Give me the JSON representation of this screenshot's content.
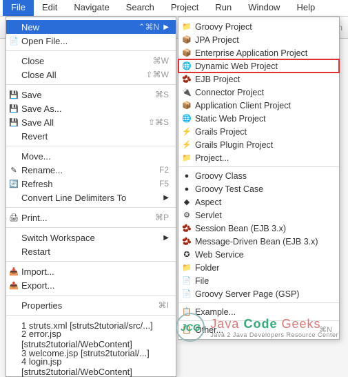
{
  "menubar": [
    "File",
    "Edit",
    "Navigate",
    "Search",
    "Project",
    "Run",
    "Window",
    "Help"
  ],
  "toolbar_right": "um",
  "file_menu": [
    {
      "label": "New",
      "shortcut": "⌃⌘N",
      "arrow": true,
      "highlight": true
    },
    {
      "label": "Open File...",
      "icon": "📄"
    },
    {
      "sep": true
    },
    {
      "label": "Close",
      "shortcut": "⌘W"
    },
    {
      "label": "Close All",
      "shortcut": "⇧⌘W"
    },
    {
      "sep": true
    },
    {
      "label": "Save",
      "icon": "💾",
      "shortcut": "⌘S"
    },
    {
      "label": "Save As...",
      "icon": "💾"
    },
    {
      "label": "Save All",
      "icon": "💾",
      "shortcut": "⇧⌘S"
    },
    {
      "label": "Revert"
    },
    {
      "sep": true
    },
    {
      "label": "Move..."
    },
    {
      "label": "Rename...",
      "icon": "✎",
      "shortcut": "F2"
    },
    {
      "label": "Refresh",
      "icon": "🔄",
      "shortcut": "F5"
    },
    {
      "label": "Convert Line Delimiters To",
      "arrow": true
    },
    {
      "sep": true
    },
    {
      "label": "Print...",
      "icon": "🖨",
      "shortcut": "⌘P"
    },
    {
      "sep": true
    },
    {
      "label": "Switch Workspace",
      "arrow": true
    },
    {
      "label": "Restart"
    },
    {
      "sep": true
    },
    {
      "label": "Import...",
      "icon": "📥"
    },
    {
      "label": "Export...",
      "icon": "📤"
    },
    {
      "sep": true
    },
    {
      "label": "Properties",
      "shortcut": "⌘I"
    },
    {
      "sep": true
    },
    {
      "label": "1 struts.xml  [struts2tutorial/src/...]"
    },
    {
      "label": "2 error.jsp  [struts2tutorial/WebContent]"
    },
    {
      "label": "3 welcome.jsp  [struts2tutorial/...]"
    },
    {
      "label": "4 login.jsp  [struts2tutorial/WebContent]"
    }
  ],
  "new_submenu": [
    {
      "label": "Groovy Project",
      "icon": "📁"
    },
    {
      "label": "JPA Project",
      "icon": "📦"
    },
    {
      "label": "Enterprise Application Project",
      "icon": "📦"
    },
    {
      "label": "Dynamic Web Project",
      "icon": "🌐",
      "boxed": true
    },
    {
      "label": "EJB Project",
      "icon": "🫘"
    },
    {
      "label": "Connector Project",
      "icon": "🔌"
    },
    {
      "label": "Application Client Project",
      "icon": "📦"
    },
    {
      "label": "Static Web Project",
      "icon": "🌐"
    },
    {
      "label": "Grails Project",
      "icon": "⚡"
    },
    {
      "label": "Grails Plugin Project",
      "icon": "⚡"
    },
    {
      "label": "Project...",
      "icon": "📁"
    },
    {
      "sep": true
    },
    {
      "label": "Groovy Class",
      "icon": "●"
    },
    {
      "label": "Groovy Test Case",
      "icon": "●"
    },
    {
      "label": "Aspect",
      "icon": "◆"
    },
    {
      "label": "Servlet",
      "icon": "⚙"
    },
    {
      "label": "Session Bean (EJB 3.x)",
      "icon": "🫘"
    },
    {
      "label": "Message-Driven Bean (EJB 3.x)",
      "icon": "🫘"
    },
    {
      "label": "Web Service",
      "icon": "✪"
    },
    {
      "label": "Folder",
      "icon": "📁"
    },
    {
      "label": "File",
      "icon": "📄"
    },
    {
      "label": "Groovy Server Page (GSP)",
      "icon": "📄"
    },
    {
      "sep": true
    },
    {
      "label": "Example...",
      "icon": "📋"
    },
    {
      "sep": true
    },
    {
      "label": "Other...",
      "icon": "📋",
      "shortcut": "⌘N"
    }
  ],
  "logo": {
    "abbr": "JCG",
    "title_a": "Java",
    "title_b": "Code",
    "title_c": "Geeks",
    "sub": "Java 2 Java Developers Resource Center"
  }
}
